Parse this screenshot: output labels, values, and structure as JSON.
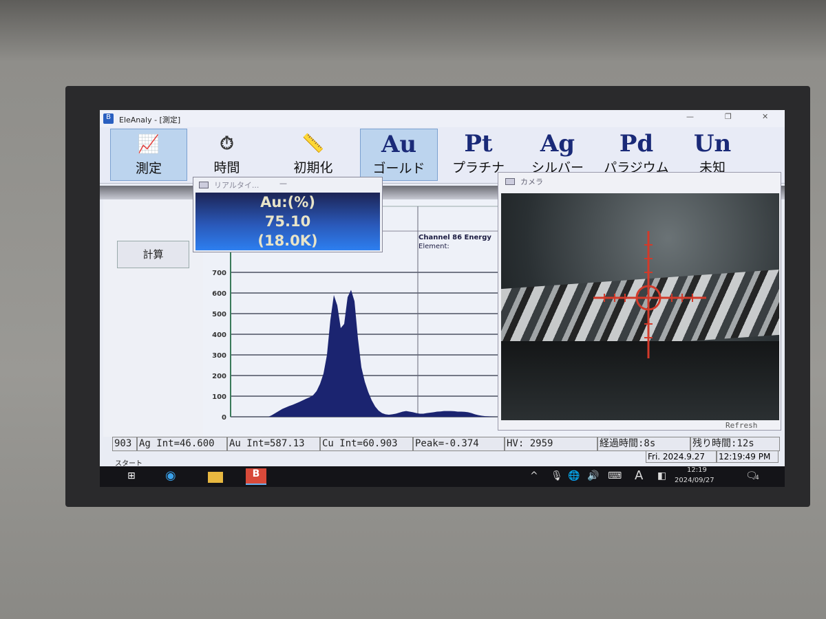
{
  "window": {
    "title": "EleAnaly - [測定]",
    "minimize": "—",
    "restore": "❐",
    "close": "✕"
  },
  "toolbar": [
    {
      "id": "measure",
      "big": "",
      "label": "測定",
      "icon": "chart-icon",
      "selected": true
    },
    {
      "id": "time",
      "big": "",
      "label": "時間",
      "icon": "stopwatch-icon",
      "selected": false
    },
    {
      "id": "init",
      "big": "",
      "label": "初期化",
      "icon": "ruler-icon",
      "selected": false
    },
    {
      "id": "au",
      "big": "Au",
      "label": "ゴールド",
      "selected": true
    },
    {
      "id": "pt",
      "big": "Pt",
      "label": "プラチナ",
      "selected": false
    },
    {
      "id": "ag",
      "big": "Ag",
      "label": "シルバー",
      "selected": false
    },
    {
      "id": "pd",
      "big": "Pd",
      "label": "パラジウム",
      "selected": false
    },
    {
      "id": "un",
      "big": "Un",
      "label": "未知",
      "selected": false
    }
  ],
  "left_panel": {
    "calc_button": "計算"
  },
  "realtime": {
    "title": "リアルタイ...",
    "minimize": "—",
    "line1": "Au:(%)",
    "line2": "75.10",
    "line3": "(18.0K)"
  },
  "chart_info": {
    "channel": "Channel 86 Energy",
    "element": "Element:"
  },
  "chart_data": {
    "type": "area",
    "color": "#1b2470",
    "grid": true,
    "yticks": [
      0,
      100,
      200,
      300,
      400,
      500,
      600,
      700
    ],
    "ylim": [
      0,
      700
    ],
    "values": [
      0,
      0,
      0,
      0,
      0,
      0,
      0,
      0,
      0,
      0,
      0,
      0,
      8,
      18,
      28,
      38,
      45,
      52,
      58,
      65,
      72,
      80,
      88,
      95,
      105,
      125,
      160,
      210,
      300,
      470,
      590,
      540,
      430,
      450,
      580,
      615,
      560,
      380,
      240,
      170,
      120,
      80,
      50,
      30,
      18,
      12,
      10,
      12,
      15,
      20,
      25,
      28,
      25,
      22,
      18,
      15,
      15,
      18,
      20,
      22,
      25,
      26,
      28,
      28,
      28,
      27,
      25,
      25,
      24,
      22,
      18,
      12,
      8,
      5,
      3,
      2,
      1,
      0,
      0
    ]
  },
  "camera": {
    "title": "カメラ",
    "refresh": "Refresh"
  },
  "status": [
    "903",
    "Ag Int=46.600",
    "Au Int=587.13",
    "Cu Int=60.903",
    "Peak=-0.374",
    "HV: 2959",
    "経過時間:8s",
    "残り時間:12s"
  ],
  "status2": {
    "start": "スタート",
    "date": "Fri. 2024.9.27",
    "time": "12:19:49 PM"
  },
  "taskbar": {
    "clock_time": "12:19",
    "clock_date": "2024/09/27",
    "ime": "A",
    "notifications": "4"
  }
}
